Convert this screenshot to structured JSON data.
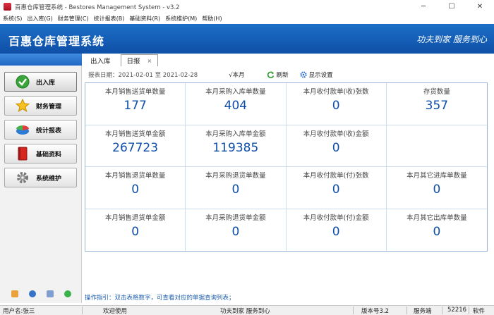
{
  "window": {
    "title": "百惠仓库管理系统 - Bestores Management System - v3.2",
    "minimize": "─",
    "maximize": "☐",
    "close": "✕"
  },
  "menu": [
    "系统(S)",
    "出入库(G)",
    "财务管理(C)",
    "统计报表(B)",
    "基础资料(R)",
    "系统维护(M)",
    "帮助(H)"
  ],
  "banner": {
    "title": "百惠仓库管理系统",
    "slogan": "功夫到家 服务到心"
  },
  "sidebar": {
    "items": [
      {
        "label": "出入库",
        "icon": "check-circle-icon"
      },
      {
        "label": "财务管理",
        "icon": "star-icon"
      },
      {
        "label": "统计报表",
        "icon": "pie-chart-icon"
      },
      {
        "label": "基础资料",
        "icon": "book-icon"
      },
      {
        "label": "系统维护",
        "icon": "gear-icon"
      }
    ]
  },
  "tabs": [
    {
      "label": "出入库"
    },
    {
      "label": "日报",
      "close": "×"
    }
  ],
  "toolbar": {
    "date_range": "报表日期：2021-02-01 至 2021-02-28",
    "this_month": "√本月",
    "refresh": "刷新",
    "display_settings": "显示设置"
  },
  "grid": [
    {
      "label": "本月销售送货单数量",
      "value": "177"
    },
    {
      "label": "本月采购入库单数量",
      "value": "404"
    },
    {
      "label": "本月收付款单(收)张数",
      "value": "0"
    },
    {
      "label": "存货数量",
      "value": "357"
    },
    {
      "label": "本月销售送货单金额",
      "value": "267723"
    },
    {
      "label": "本月采购入库单金额",
      "value": "119385"
    },
    {
      "label": "本月收付款单(收)金额",
      "value": "0"
    },
    {
      "label": "",
      "value": ""
    },
    {
      "label": "本月销售退货单数量",
      "value": "0"
    },
    {
      "label": "本月采购退货单数量",
      "value": "0"
    },
    {
      "label": "本月收付款单(付)张数",
      "value": "0"
    },
    {
      "label": "本月其它进库单数量",
      "value": "0"
    },
    {
      "label": "本月销售退货单金额",
      "value": "0"
    },
    {
      "label": "本月采购退货单金额",
      "value": "0"
    },
    {
      "label": "本月收付款单(付)金额",
      "value": "0"
    },
    {
      "label": "本月其它出库单数量",
      "value": "0"
    }
  ],
  "hint": "操作指引：双击表格数字，可查看对应的单据查询列表；",
  "status": {
    "user": "用户名:张三",
    "welcome": "欢迎使用",
    "slogan": "功夫到家 服务到心",
    "version": "版本号3.2",
    "server": "服务端",
    "port": "52216",
    "software": "软件"
  },
  "colors": {
    "banner": "#1562bb",
    "value_text": "#0e4ea8",
    "hint_text": "#1f5fb0"
  }
}
